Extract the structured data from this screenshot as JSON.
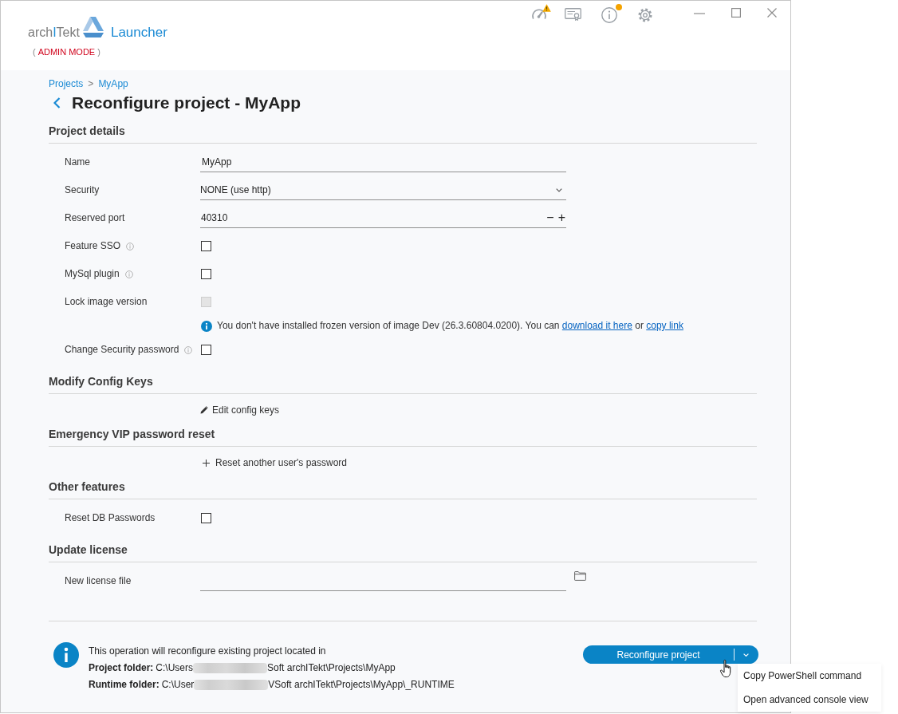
{
  "toolbar": [
    {
      "kind": "gauge",
      "badge": true
    },
    {
      "kind": "certificate",
      "badge": false
    },
    {
      "kind": "info",
      "badge": true
    },
    {
      "kind": "settings",
      "badge": false
    }
  ],
  "logo": {
    "wordmark": [
      {
        "text": "arch",
        "accent": false
      },
      {
        "text": "I",
        "accent": true
      },
      {
        "text": "Tekt",
        "accent": false
      }
    ],
    "product": "Launcher"
  },
  "mode": {
    "open": "(",
    "label": "ADMIN MODE",
    "close": ")"
  },
  "breadcrumb": {
    "items": [
      "Projects",
      "MyApp"
    ],
    "separator": ">"
  },
  "title": "Reconfigure project - MyApp",
  "sections": [
    {
      "title": "Project details",
      "rows": [
        {
          "kind": "text",
          "label": "Name",
          "value": "MyApp"
        },
        {
          "kind": "select",
          "label": "Security",
          "value": "NONE (use http)"
        },
        {
          "kind": "stepper",
          "label": "Reserved port",
          "value": "40310",
          "minus": "−",
          "plus": "+"
        },
        {
          "kind": "checkbox",
          "label": "Feature SSO",
          "info": true,
          "checked": false,
          "disabled": false
        },
        {
          "kind": "checkbox",
          "label": "MySql plugin",
          "info": true,
          "checked": false,
          "disabled": false
        },
        {
          "kind": "checkbox",
          "label": "Lock image version",
          "info": false,
          "checked": false,
          "disabled": true
        },
        {
          "kind": "notice",
          "parts": [
            {
              "text": "You don't have installed frozen version of image  Dev (26.3.60804.0200).  You can ",
              "link": false
            },
            {
              "text": "download it here",
              "link": true
            },
            {
              "text": " or ",
              "link": false
            },
            {
              "text": "copy link",
              "link": true
            }
          ]
        },
        {
          "kind": "checkbox",
          "label": "Change Security password",
          "info": true,
          "checked": false,
          "disabled": false
        }
      ]
    },
    {
      "title": "Modify Config Keys",
      "rows": [
        {
          "kind": "edit",
          "text": "Edit config keys"
        }
      ]
    },
    {
      "title": "Emergency VIP password reset",
      "rows": [
        {
          "kind": "add",
          "text": "Reset another user's password"
        }
      ]
    },
    {
      "title": "Other features",
      "rows": [
        {
          "kind": "checkbox",
          "label": "Reset DB Passwords",
          "info": false,
          "checked": false,
          "disabled": false
        }
      ]
    },
    {
      "title": "Update license",
      "rows": [
        {
          "kind": "file",
          "label": "New license file"
        }
      ]
    }
  ],
  "footer": {
    "intro": "This operation will reconfigure existing project located in",
    "folders": [
      {
        "label": "Project folder:",
        "path_start": "C:\\Users",
        "redacted": true,
        "path_end": "Soft archITekt\\Projects\\MyApp"
      },
      {
        "label": "Runtime folder:",
        "path_start": "C:\\User",
        "redacted": true,
        "path_end": "VSoft archITekt\\Projects\\MyApp\\_RUNTIME"
      }
    ]
  },
  "action_button": {
    "label": "Reconfigure project",
    "menu_open": true,
    "menu": [
      "Copy PowerShell command",
      "Open advanced console view"
    ]
  }
}
